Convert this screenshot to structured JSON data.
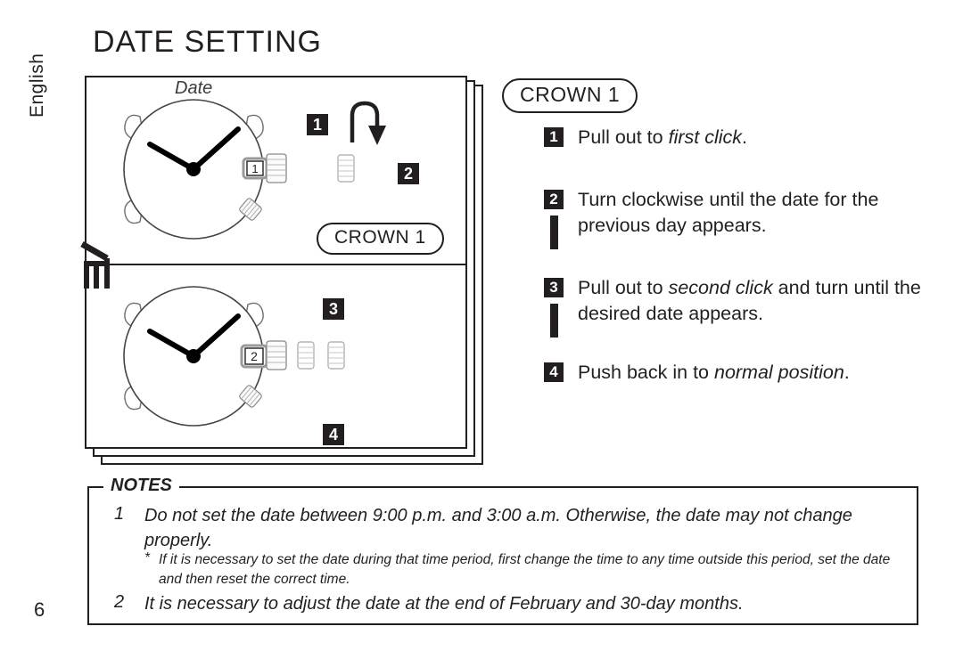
{
  "page": {
    "language_label": "English",
    "page_number": "6",
    "title": "DATE SETTING"
  },
  "diagram": {
    "date_caption": "Date",
    "crown_pill_label": "CROWN 1",
    "top_watch": {
      "date_window_value": "1",
      "badges": [
        "1",
        "2"
      ],
      "arrow_icon": "u-turn-down-arrow-icon",
      "crown_positions": [
        "normal",
        "first-click"
      ]
    },
    "bottom_watch": {
      "date_window_value": "2",
      "badges": [
        "3",
        "4"
      ],
      "crown_positions": [
        "normal",
        "first-click",
        "second-click"
      ]
    }
  },
  "instructions": {
    "heading_pill": "CROWN 1",
    "steps": [
      {
        "number": "1",
        "parts": [
          {
            "text": "Pull out to ",
            "italic": false
          },
          {
            "text": "first click",
            "italic": true
          },
          {
            "text": ".",
            "italic": false
          }
        ],
        "has_connector": false
      },
      {
        "number": "2",
        "parts": [
          {
            "text": "Turn clockwise until the date for the previous day appears.",
            "italic": false
          }
        ],
        "has_connector": true
      },
      {
        "number": "3",
        "parts": [
          {
            "text": "Pull out to ",
            "italic": false
          },
          {
            "text": "second click",
            "italic": true
          },
          {
            "text": " and turn until the desired date appears.",
            "italic": false
          }
        ],
        "has_connector": true
      },
      {
        "number": "4",
        "parts": [
          {
            "text": "Push back in to ",
            "italic": false
          },
          {
            "text": "normal position",
            "italic": true
          },
          {
            "text": ".",
            "italic": false
          }
        ],
        "has_connector": false
      }
    ]
  },
  "notes": {
    "legend": "NOTES",
    "items": [
      {
        "number": "1",
        "text": "Do not set the date between 9:00 p.m. and 3:00 a.m.  Otherwise, the date may not change properly.",
        "sub": {
          "marker": "*",
          "text": "If it is necessary to set the date during that time period, first change the time to any time outside this period, set the date and then reset the correct time."
        }
      },
      {
        "number": "2",
        "text": "It is necessary to adjust the date at the end of February and 30-day months.",
        "sub": null
      }
    ]
  },
  "colors": {
    "ink": "#231f20",
    "paper": "#ffffff",
    "outline": "#555555"
  }
}
